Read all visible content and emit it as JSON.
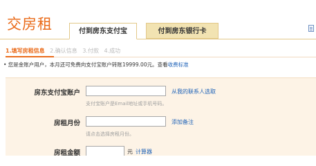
{
  "header": {
    "title": "交房租",
    "tabs": [
      {
        "label": "付到房东支付宝",
        "active": true
      },
      {
        "label": "付到房东银行卡",
        "active": false
      }
    ],
    "corner_icon": "document-icon"
  },
  "steps": [
    {
      "label": "1.填写房租信息",
      "active": true
    },
    {
      "label": "2.确认信息",
      "active": false
    },
    {
      "label": "3.付款",
      "active": false
    },
    {
      "label": "4.成功",
      "active": false
    }
  ],
  "notice": {
    "prefix": "• 您是金账户用户，本月还可免费向支付宝账户转账",
    "amount": "19999.00元",
    "middle": "。查看",
    "link": "收费标准"
  },
  "form": {
    "fields": [
      {
        "label": "房东支付宝账户",
        "value": "",
        "link": "从我的联系人选取",
        "hint": "支付宝账户是Email地址或手机号码。"
      },
      {
        "label": "房租月份",
        "value": "",
        "link": "添加备注",
        "hint": "请点击选择房租月份。"
      },
      {
        "label": "房租金额",
        "value": "",
        "unit": "元",
        "link": "计算器"
      }
    ]
  },
  "colors": {
    "accent": "#ea6b1a",
    "link": "#1f63b8",
    "tab_inactive_bg": "#f2e3b2",
    "form_bg": "#fdf3e6"
  }
}
